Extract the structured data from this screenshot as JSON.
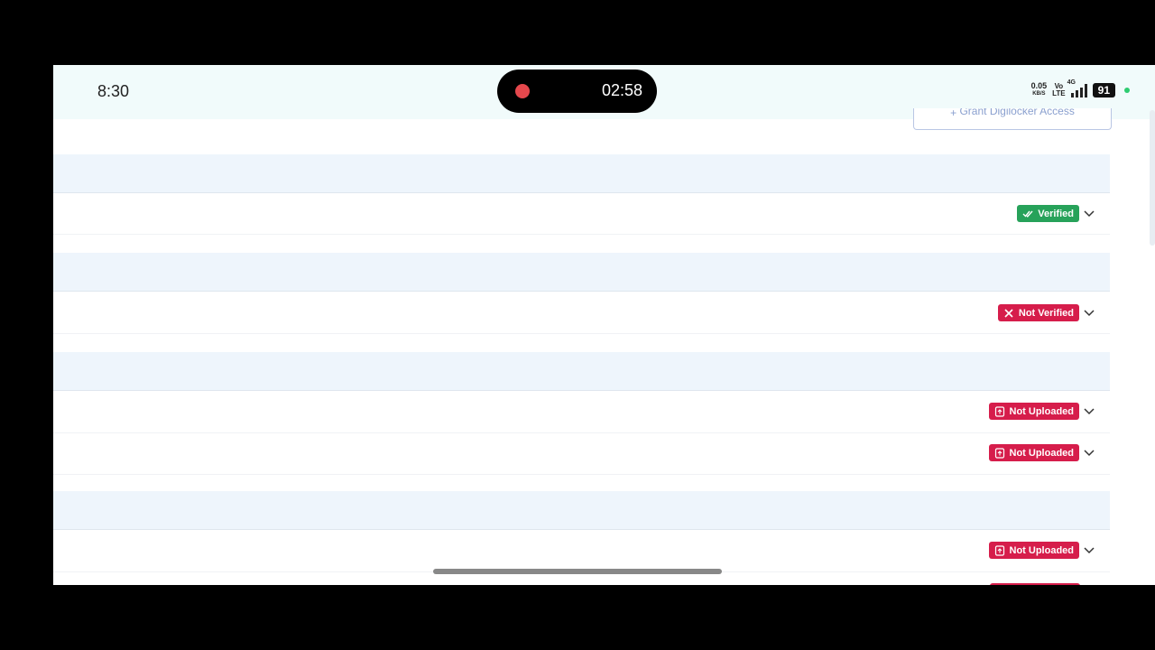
{
  "status_bar": {
    "time": "8:30",
    "recording_time": "02:58",
    "net_speed": "0.05",
    "net_speed_unit": "KB/S",
    "volte_top": "Vo",
    "volte_bottom": "LTE",
    "network_type": "4G",
    "battery": "91"
  },
  "digilocker_button": {
    "label": "Grant Digilocker Access"
  },
  "documents": [
    {
      "status": "Verified",
      "status_color": "#27a25a",
      "icon": "double-check-icon"
    },
    {
      "status": "Not Verified",
      "status_color": "#d61d4b",
      "icon": "close-icon"
    },
    {
      "status": "Not Uploaded",
      "status_color": "#d61d4b",
      "icon": "file-upload-icon"
    },
    {
      "status": "Not Uploaded",
      "status_color": "#d61d4b",
      "icon": "file-upload-icon"
    },
    {
      "status": "Not Uploaded",
      "status_color": "#d61d4b",
      "icon": "file-upload-icon"
    }
  ]
}
